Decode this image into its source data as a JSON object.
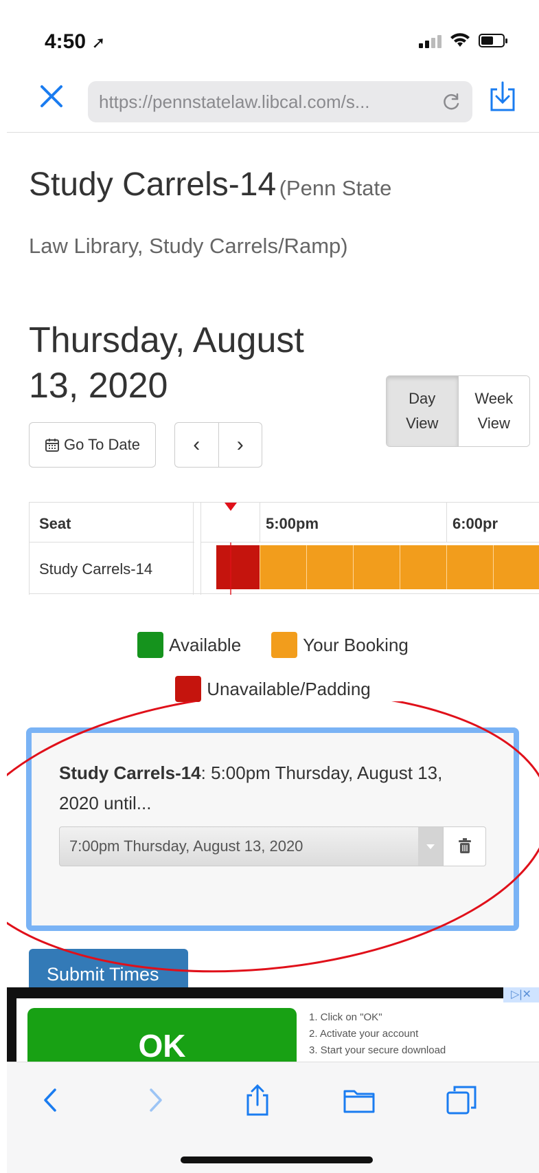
{
  "status_bar": {
    "time": "4:50"
  },
  "browser": {
    "url": "https://pennstatelaw.libcal.com/s..."
  },
  "page": {
    "title": "Study Carrels-14",
    "location": "(Penn State",
    "location_line2": "Law Library, Study Carrels/Ramp)",
    "date_line1": "Thursday, August",
    "date_line2": "13, 2020"
  },
  "view_toggle": {
    "day_line1": "Day",
    "day_line2": "View",
    "week_line1": "Week",
    "week_line2": "View",
    "active": "day"
  },
  "go_to_date": "Go To Date",
  "pager": {
    "prev": "‹",
    "next": "›"
  },
  "grid": {
    "seat_header": "Seat",
    "seat_name": "Study Carrels-14",
    "time_labels": [
      "5:00pm",
      "6:00pr"
    ],
    "slots": [
      {
        "status": "unavailable"
      },
      {
        "status": "booking"
      },
      {
        "status": "booking"
      },
      {
        "status": "booking"
      },
      {
        "status": "booking"
      },
      {
        "status": "booking"
      },
      {
        "status": "booking"
      }
    ]
  },
  "legend": {
    "available": "Available",
    "your_booking": "Your Booking",
    "unavailable": "Unavailable/Padding"
  },
  "colors": {
    "available": "#15931d",
    "booking": "#f29d1c",
    "unavailable": "#c5140d",
    "panel_border": "#7ab3f5",
    "submit": "#337ab7",
    "annotation": "#e0101a"
  },
  "booking": {
    "space": "Study Carrels-14",
    "details": ": 5:00pm Thursday, August 13, 2020 until...",
    "until_value": "7:00pm Thursday, August 13, 2020"
  },
  "submit_label": "Submit Times",
  "ad": {
    "ok_label": "OK",
    "steps": [
      "1. Click on \"OK\"",
      "2. Activate your account",
      "3. Start your secure download"
    ],
    "badge": "▷|✕"
  },
  "toolbar_icons": [
    "back-icon",
    "forward-icon",
    "share-icon",
    "bookmarks-icon",
    "tabs-icon"
  ]
}
